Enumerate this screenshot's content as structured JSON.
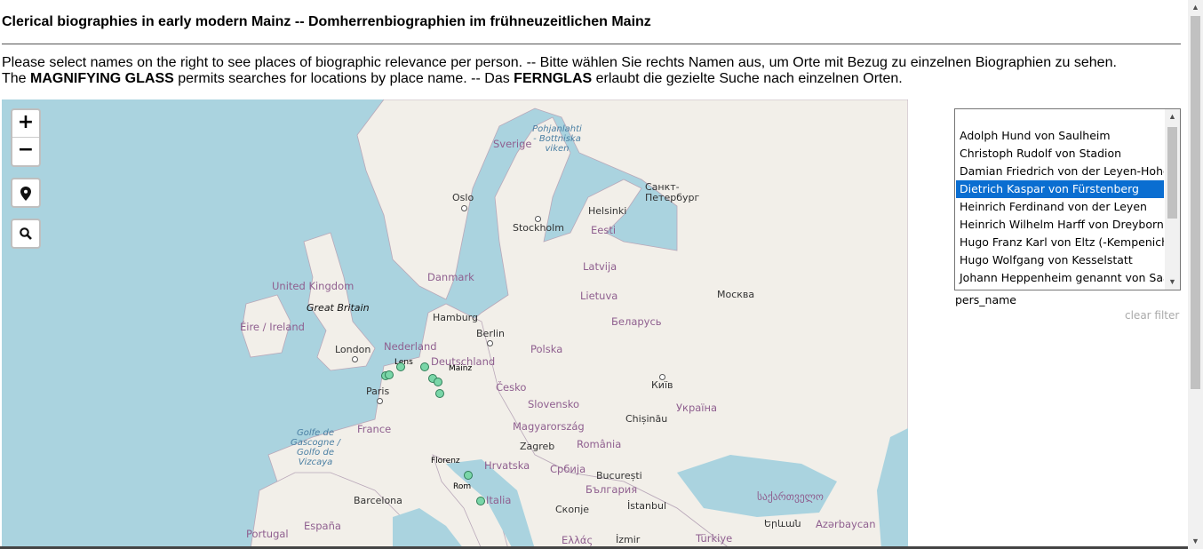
{
  "header": {
    "title": "Clerical biographies in early modern Mainz -- Domherrenbiographien im frühneuzeitlichen Mainz"
  },
  "intro": {
    "line1": "Please select names on the right to see places of biographic relevance per person. -- Bitte wählen Sie rechts Namen aus, um Orte mit Bezug zu einzelnen Biographien zu sehen.",
    "line2_prefix": "The ",
    "line2_bold1": "MAGNIFYING GLASS",
    "line2_mid": " permits searches for locations by place name. -- Das ",
    "line2_bold2": "FERNGLAS",
    "line2_suffix": " erlaubt die gezielte Suche nach einzelnen Orten."
  },
  "map": {
    "zoom_in": "+",
    "zoom_out": "−",
    "locate_icon": "map-pin-icon",
    "search_icon": "search-icon",
    "labels": {
      "united_kingdom": "United Kingdom",
      "great_britain": "Great Britain",
      "eire": "Éire / Ireland",
      "london": "London",
      "nederland": "Nederland",
      "lens": "Lens",
      "mainz": "Mainz",
      "deutschland": "Deutschland",
      "hamburg": "Hamburg",
      "berlin": "Berlin",
      "danmark": "Danmark",
      "oslo": "Oslo",
      "stockholm": "Stockholm",
      "sverige": "Sverige",
      "bothnian": "Pohjanlahti - Bottniska viken",
      "helsinki": "Helsinki",
      "eesti": "Eesti",
      "spb": "Санкт-Петербург",
      "latvija": "Latvija",
      "lietuva": "Lietuva",
      "moskva": "Москва",
      "belarus": "Беларусь",
      "polska": "Polska",
      "paris": "Paris",
      "cesko": "Česko",
      "kyiv": "Київ",
      "ukraina": "Україна",
      "slovensko": "Slovensko",
      "france": "France",
      "magyarorszag": "Magyarország",
      "chisinau": "Chișinău",
      "golfe": "Golfe de Gascogne / Golfo de Vizcaya",
      "zagreb": "Zagreb",
      "romania": "România",
      "florenz": "Florenz",
      "hrvatska": "Hrvatska",
      "srbija": "Србија",
      "bucuresti": "București",
      "rom": "Rom",
      "blgariya": "България",
      "barcelona": "Barcelona",
      "italia": "Italia",
      "skopje": "Скопје",
      "istanbul": "İstanbul",
      "georgia": "საქართველო",
      "portugal": "Portugal",
      "espana": "España",
      "ellas": "Ελλάς",
      "izmir": "İzmir",
      "turkiye": "Türkiye",
      "yerevan": "Երևան",
      "azerbaycan": "Azərbaycan"
    }
  },
  "names_list": {
    "options": [
      "",
      "Adolph Hund von Saulheim",
      "Christoph Rudolf von Stadion",
      "Damian Friedrich von der Leyen-Hohengeroldseck",
      "Dietrich Kaspar von Fürstenberg",
      "Heinrich Ferdinand von der Leyen",
      "Heinrich Wilhelm Harff von Dreyborn",
      "Hugo Franz Karl von Eltz (-Kempenich)",
      "Hugo Wolfgang von Kesselstatt",
      "Johann Heppenheim genannt von Saal"
    ],
    "selected": "Dietrich Kaspar von Fürstenberg",
    "field_label": "pers_name",
    "clear_filter": "clear filter"
  }
}
